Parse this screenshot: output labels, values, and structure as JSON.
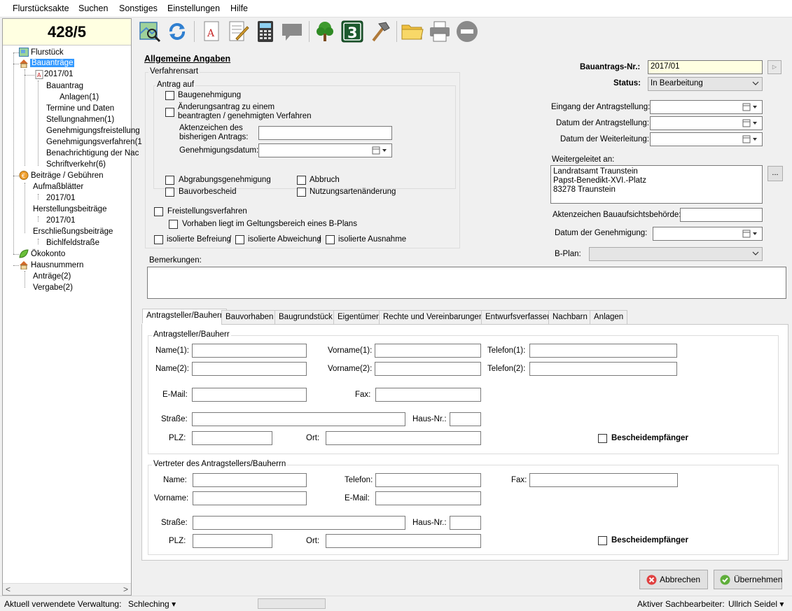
{
  "menu": [
    "Flurstücksakte",
    "Suchen",
    "Sonstiges",
    "Einstellungen",
    "Hilfe"
  ],
  "parcel_number": "428/5",
  "tree": {
    "flurstueck": "Flurstück",
    "bauantraege": "Bauanträge",
    "year": "2017/01",
    "bauantrag": "Bauantrag",
    "anlagen": "Anlagen(1)",
    "termine": "Termine und Daten",
    "stellungnahmen": "Stellungnahmen(1)",
    "genehmigungsfreistellung": "Genehmigungsfreistellung",
    "genehmigungsverfahren": "Genehmigungsverfahren(1",
    "benachrichtigung": "Benachrichtigung der Nac",
    "schriftverkehr": "Schriftverkehr(6)",
    "beitraege": "Beiträge / Gebühren",
    "aufmassblaetter": "Aufmaßblätter",
    "aufmass_year": "2017/01",
    "herstellungsbeitraege": "Herstellungsbeiträge",
    "herstellung_year": "2017/01",
    "erschliessungsbeitraege": "Erschließungsbeiträge",
    "bichlfeldstrasse": "Bichlfeldstraße",
    "oekokonto": "Ökokonto",
    "hausnummern": "Hausnummern",
    "antraege": "Anträge(2)",
    "vergabe": "Vergabe(2)"
  },
  "toolbar_icons": [
    "map-search-icon",
    "refresh-icon",
    "document-icon",
    "edit-document-icon",
    "calculator-icon",
    "comment-icon",
    "tree-icon",
    "number-three-icon",
    "hammer-icon",
    "folder-icon",
    "printer-icon",
    "minus-circle-icon"
  ],
  "section_title": "Allgemeine Angaben",
  "verfahrensart": {
    "title": "Verfahrensart",
    "antrag_auf": "Antrag auf",
    "baugenehmigung": "Baugenehmigung",
    "aenderungsantrag_1": "Änderungsantrag zu einem",
    "aenderungsantrag_2": "beantragten / genehmigten Verfahren",
    "aktenzeichen_1": "Aktenzeichen des",
    "aktenzeichen_2": "bisherigen Antrags:",
    "genehmigungsdatum": "Genehmigungsdatum:",
    "abgrabung": "Abgrabungsgenehmigung",
    "abbruch": "Abbruch",
    "bauvorbescheid": "Bauvorbescheid",
    "nutzungsart": "Nutzungsartenänderung",
    "freistellung": "Freistellungsverfahren",
    "vorhaben": "Vorhaben liegt im Geltungsbereich eines B-Plans",
    "isol_befreiung": "isolierte Befreiung",
    "slash1": "/",
    "isol_abweichung": "isolierte Abweichung",
    "slash2": "/",
    "isol_ausnahme": "isolierte Ausnahme"
  },
  "right": {
    "bauantrag_nr_label": "Bauantrags-Nr.:",
    "bauantrag_nr": "2017/01",
    "status_label": "Status:",
    "status": "In Bearbeitung",
    "eingang_label": "Eingang der Antragstellung:",
    "datum_antrag_label": "Datum der Antragstellung:",
    "weiterleitung_label": "Datum der Weiterleitung:",
    "weitergeleitet_label": "Weitergeleitet an:",
    "weitergeleitet_lines": [
      "Landratsamt Traunstein",
      "Papst-Benedikt-XVI.-Platz",
      "83278 Traunstein"
    ],
    "ellipsis": "...",
    "aktenzeichen_label": "Aktenzeichen Bauaufsichtsbehörde:",
    "datum_genehmigung_label": "Datum der Genehmigung:",
    "bplan_label": "B-Plan:"
  },
  "bemerkungen_label": "Bemerkungen:",
  "tabs": [
    "Antragsteller/Bauherr",
    "Bauvorhaben",
    "Baugrundstück",
    "Eigentümer",
    "Rechte und Vereinbarungen",
    "Entwurfsverfasser",
    "Nachbarn",
    "Anlagen"
  ],
  "applicant": {
    "title": "Antragsteller/Bauherr",
    "name1": "Name(1):",
    "vorname1": "Vorname(1):",
    "telefon1": "Telefon(1):",
    "name2": "Name(2):",
    "vorname2": "Vorname(2):",
    "telefon2": "Telefon(2):",
    "email": "E-Mail:",
    "fax": "Fax:",
    "strasse": "Straße:",
    "hausnr": "Haus-Nr.:",
    "plz": "PLZ:",
    "ort": "Ort:",
    "bescheid": "Bescheidempfänger"
  },
  "representative": {
    "title": "Vertreter des Antragstellers/Bauherrn",
    "name": "Name:",
    "telefon": "Telefon:",
    "fax": "Fax:",
    "vorname": "Vorname:",
    "email": "E-Mail:",
    "strasse": "Straße:",
    "hausnr": "Haus-Nr.:",
    "plz": "PLZ:",
    "ort": "Ort:",
    "bescheid": "Bescheidempfänger"
  },
  "buttons": {
    "cancel": "Abbrechen",
    "apply": "Übernehmen"
  },
  "statusbar": {
    "verwaltung_label": "Aktuell verwendete Verwaltung:",
    "verwaltung": "Schleching",
    "sachbearbeiter_label": "Aktiver Sachbearbeiter:",
    "sachbearbeiter": "Ullrich Seidel"
  },
  "colors": {
    "selection": "#3399ff",
    "highlight_field": "#ffffe1"
  }
}
